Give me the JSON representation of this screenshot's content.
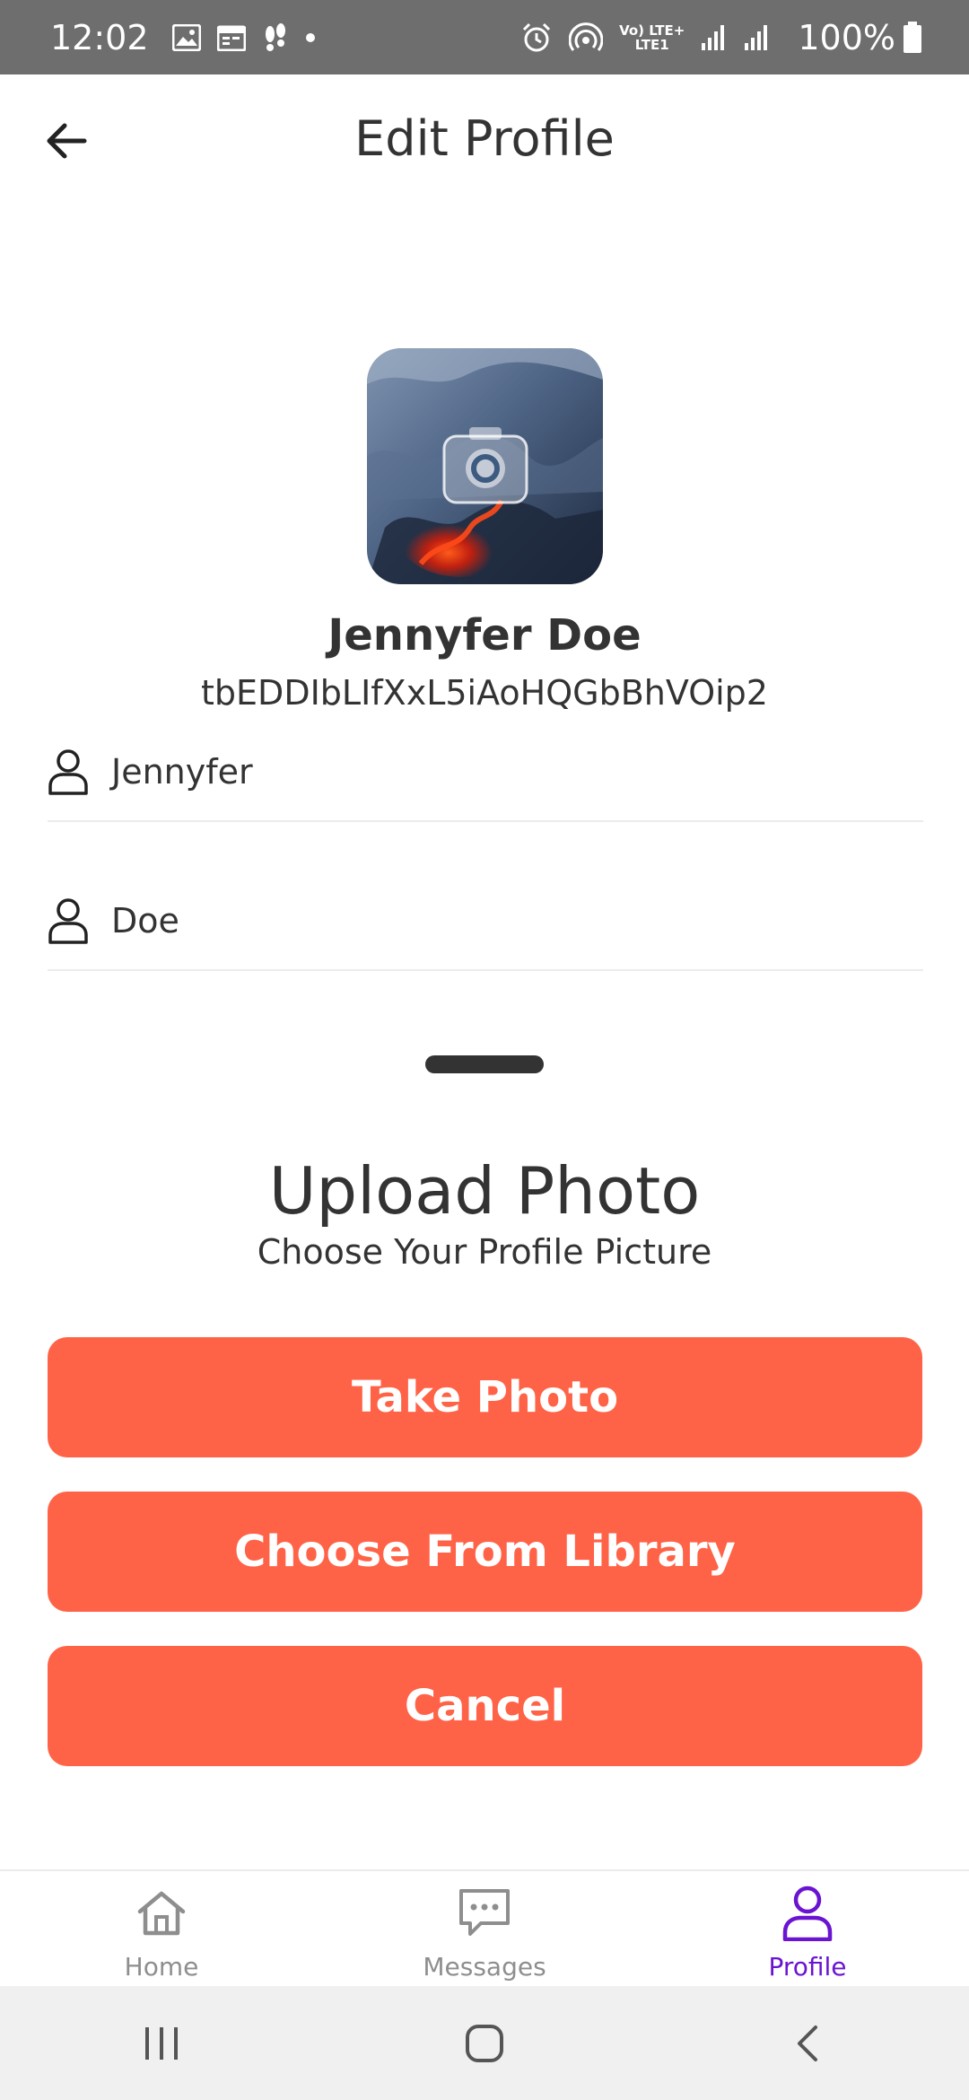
{
  "status_bar": {
    "time": "12:02",
    "network_label_top": "Vo) LTE+",
    "network_label_bottom": "LTE1",
    "battery": "100%"
  },
  "header": {
    "title": "Edit Profile"
  },
  "profile": {
    "name": "Jennyfer Doe",
    "user_id": "tbEDDIbLIfXxL5iAoHQGbBhVOip2"
  },
  "fields": {
    "first_name": "Jennyfer",
    "last_name": "Doe"
  },
  "sheet": {
    "title": "Upload Photo",
    "subtitle": "Choose Your Profile Picture",
    "take_photo_label": "Take Photo",
    "library_label": "Choose From Library",
    "cancel_label": "Cancel"
  },
  "bottom_nav": {
    "items": [
      {
        "label": "Home",
        "icon": "home-icon"
      },
      {
        "label": "Messages",
        "icon": "messages-icon"
      },
      {
        "label": "Profile",
        "icon": "profile-icon",
        "active": true
      }
    ]
  },
  "colors": {
    "accent_button": "#ff6347",
    "active_nav": "#6a14d1",
    "status_bar": "#6e6e6e"
  }
}
